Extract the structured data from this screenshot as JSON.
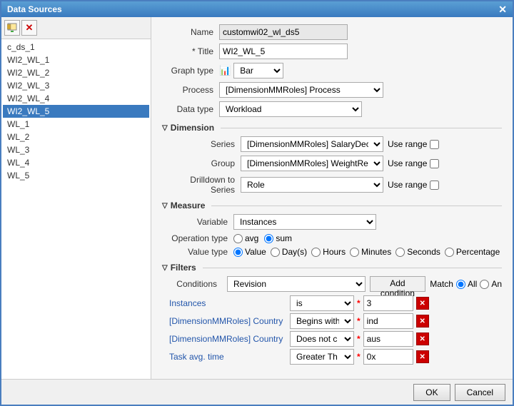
{
  "dialog": {
    "title": "Data Sources",
    "close_label": "✕"
  },
  "toolbar": {
    "add_icon": "📁",
    "delete_icon": "✕"
  },
  "tree": {
    "items": [
      {
        "label": "c_ds_1",
        "selected": false
      },
      {
        "label": "WI2_WL_1",
        "selected": false
      },
      {
        "label": "WI2_WL_2",
        "selected": false
      },
      {
        "label": "WI2_WL_3",
        "selected": false
      },
      {
        "label": "WI2_WL_4",
        "selected": false
      },
      {
        "label": "WI2_WL_5",
        "selected": true
      },
      {
        "label": "WL_1",
        "selected": false
      },
      {
        "label": "WL_2",
        "selected": false
      },
      {
        "label": "WL_3",
        "selected": false
      },
      {
        "label": "WL_4",
        "selected": false
      },
      {
        "label": "WL_5",
        "selected": false
      }
    ]
  },
  "form": {
    "name_label": "Name",
    "name_value": "customwi02_wl_ds5",
    "title_label": "* Title",
    "title_value": "WI2_WL_5",
    "graph_type_label": "Graph type",
    "graph_type_value": "Bar",
    "process_label": "Process",
    "process_value": "[DimensionMMRoles] Process",
    "data_type_label": "Data type",
    "data_type_value": "Workload"
  },
  "dimension": {
    "header": "Dimension",
    "series_label": "Series",
    "series_value": "[DimensionMMRoles] SalaryDecimalInput",
    "use_range_label": "Use range",
    "group_label": "Group",
    "group_value": "[DimensionMMRoles] WeightRealDimension",
    "drilldown_label": "Drilldown to Series",
    "drilldown_value": "Role"
  },
  "measure": {
    "header": "Measure",
    "variable_label": "Variable",
    "variable_value": "Instances",
    "operation_type_label": "Operation type",
    "op_avg": "avg",
    "op_sum": "sum",
    "value_type_label": "Value type",
    "vt_value": "Value",
    "vt_days": "Day(s)",
    "vt_hours": "Hours",
    "vt_minutes": "Minutes",
    "vt_seconds": "Seconds",
    "vt_percentage": "Percentage"
  },
  "filters": {
    "header": "Filters",
    "conditions_label": "Conditions",
    "conditions_value": "Revision",
    "add_condition_label": "Add condition",
    "match_label": "Match",
    "all_label": "All",
    "an_label": "An",
    "rows": [
      {
        "label": "Instances",
        "operator": "is",
        "asterisk": "*",
        "value": "3"
      },
      {
        "label": "[DimensionMMRoles] Country",
        "operator": "Begins with",
        "asterisk": "*",
        "value": "ind"
      },
      {
        "label": "[DimensionMMRoles] Country",
        "operator": "Does not c",
        "asterisk": "*",
        "value": "aus"
      },
      {
        "label": "Task avg. time",
        "operator": "Greater Th",
        "asterisk": "*",
        "value": "0x"
      }
    ]
  },
  "buttons": {
    "ok_label": "OK",
    "cancel_label": "Cancel"
  }
}
